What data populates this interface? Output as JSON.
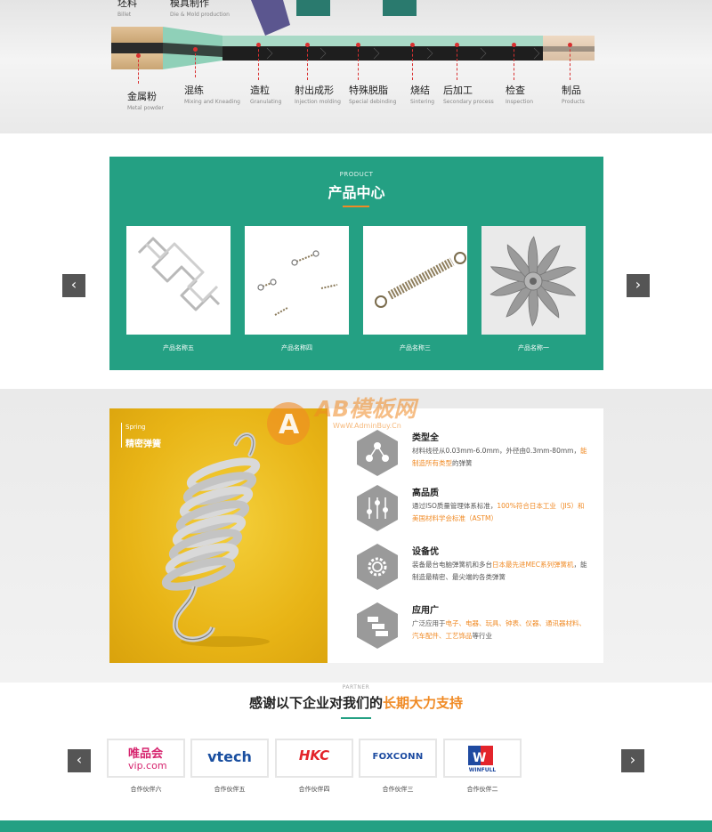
{
  "process": {
    "top_labels": [
      {
        "text": "坯料",
        "en": "Billet"
      },
      {
        "text": "模具制作",
        "en": "Die & Mold production"
      }
    ],
    "steps": [
      {
        "cn": "金属粉",
        "en": "Metal powder"
      },
      {
        "cn": "混练",
        "en": "Mixing and Kneading"
      },
      {
        "cn": "造粒",
        "en": "Granulating"
      },
      {
        "cn": "射出成形",
        "en": "Injection molding"
      },
      {
        "cn": "特殊脱脂",
        "en": "Special debinding"
      },
      {
        "cn": "烧结",
        "en": "Sintering"
      },
      {
        "cn": "后加工",
        "en": "Secondary process"
      },
      {
        "cn": "检查",
        "en": "Inspection"
      },
      {
        "cn": "制品",
        "en": "Products"
      }
    ]
  },
  "products": {
    "sub": "PRODUCT",
    "title": "产品中心",
    "prev": "‹",
    "next": "›",
    "items": [
      {
        "name": "产品名称五"
      },
      {
        "name": "产品名称四"
      },
      {
        "name": "产品名称三"
      },
      {
        "name": "产品名称一"
      }
    ]
  },
  "features": {
    "banner_en": "Spring",
    "banner_cn": "精密弹簧",
    "items": [
      {
        "title": "类型全",
        "pre": "材料线径从0.03mm-6.0mm，外径由0.3mm-80mm，",
        "hl": "能制造所有类型",
        "post": "的弹簧",
        "icon": "network-icon"
      },
      {
        "title": "高品质",
        "pre": "通过ISO质量管理体系标准，",
        "hl": "100%符合日本工业（JIS）和美国材料学会标准（ASTM）",
        "post": "",
        "icon": "sliders-icon"
      },
      {
        "title": "设备优",
        "pre": "装备最台电脑弹簧机和多台",
        "hl": "日本最先进MEC系列弹簧机",
        "post": "，能制造最精密、最尖端的各类弹簧",
        "icon": "gear-icon"
      },
      {
        "title": "应用广",
        "pre": "广泛应用于",
        "hl": "电子、电器、玩具、钟表、仪器、通讯器材料、汽车配件、工艺饰品",
        "post": "等行业",
        "icon": "blocks-icon"
      }
    ]
  },
  "watermark": {
    "main": "AB模板网",
    "url": "WwW.AdminBuy.Cn"
  },
  "partners": {
    "sub": "PARTNER",
    "title_pre": "感谢以下企业对我们的",
    "title_hl": "长期大力支持",
    "prev": "‹",
    "next": "›",
    "items": [
      {
        "name": "合作伙伴六",
        "logo_top": "唯品会",
        "logo_bottom": "vip.com"
      },
      {
        "name": "合作伙伴五",
        "logo": "vtech"
      },
      {
        "name": "合作伙伴四",
        "logo": "HKC"
      },
      {
        "name": "合作伙伴三",
        "logo": "FOXCONN"
      },
      {
        "name": "合作伙伴二",
        "logo": "WINFULL"
      }
    ]
  },
  "colors": {
    "accent": "#24a083",
    "highlight": "#f08a24",
    "spring_bg": "#e8b416"
  }
}
